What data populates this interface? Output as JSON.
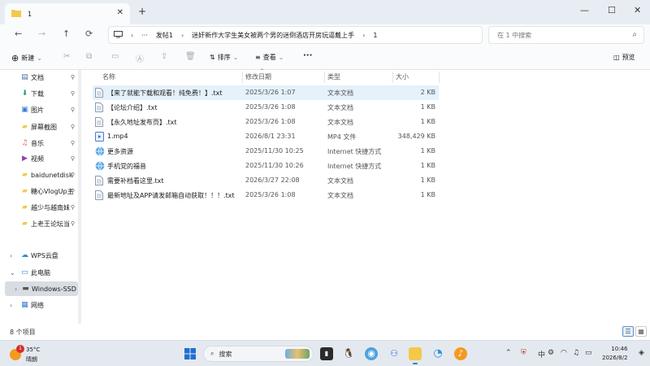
{
  "tab": {
    "title": "1",
    "close": "✕",
    "new": "+"
  },
  "window_controls": {
    "minimize": "—",
    "maximize": "☐",
    "close": "✕"
  },
  "nav": {
    "back": "←",
    "forward": "→",
    "up": "↑",
    "refresh": "⟳",
    "more": "···"
  },
  "address": {
    "segments": [
      "发帖1",
      "迷奸新作大学生美女被两个男的迷倒酒店开房玩逼戴上手",
      "1"
    ],
    "separator": "›"
  },
  "search": {
    "placeholder": "在 1 中搜索"
  },
  "commands": {
    "new": "新建",
    "sort": "排序",
    "view": "查看",
    "more": "···",
    "preview": "预览"
  },
  "columns": {
    "name": "名称",
    "date": "修改日期",
    "type": "类型",
    "size": "大小"
  },
  "files": [
    {
      "name": "【来了就能下载和观看！纯免费！】.txt",
      "date": "2025/3/26 1:07",
      "type": "文本文档",
      "size": "2 KB",
      "icon": "text-file-icon"
    },
    {
      "name": "【论坛介绍】.txt",
      "date": "2025/3/26 1:08",
      "type": "文本文档",
      "size": "1 KB",
      "icon": "text-file-icon"
    },
    {
      "name": "【永久地址发布页】.txt",
      "date": "2025/3/26 1:08",
      "type": "文本文档",
      "size": "1 KB",
      "icon": "text-file-icon"
    },
    {
      "name": "1.mp4",
      "date": "2026/8/1 23:31",
      "type": "MP4 文件",
      "size": "348,429 KB",
      "icon": "video-file-icon"
    },
    {
      "name": "更多资源",
      "date": "2025/11/30 10:25",
      "type": "Internet 快捷方式",
      "size": "1 KB",
      "icon": "internet-shortcut-icon"
    },
    {
      "name": "手机党的福音",
      "date": "2025/11/30 10:26",
      "type": "Internet 快捷方式",
      "size": "1 KB",
      "icon": "internet-shortcut-icon"
    },
    {
      "name": "需要补档看这里.txt",
      "date": "2026/3/27 22:08",
      "type": "文本文档",
      "size": "1 KB",
      "icon": "text-file-icon"
    },
    {
      "name": "最新地址及APP请发邮箱自动获取！！！.txt",
      "date": "2025/3/26 1:08",
      "type": "文本文档",
      "size": "1 KB",
      "icon": "text-file-icon"
    }
  ],
  "sidebar": [
    {
      "label": "文档",
      "icon": "documents-icon",
      "pinned": true
    },
    {
      "label": "下载",
      "icon": "downloads-icon",
      "pinned": true
    },
    {
      "label": "图片",
      "icon": "pictures-icon",
      "pinned": true
    },
    {
      "label": "屏幕截图",
      "icon": "folder-icon",
      "pinned": true
    },
    {
      "label": "音乐",
      "icon": "music-icon",
      "pinned": true
    },
    {
      "label": "视频",
      "icon": "videos-icon",
      "pinned": true
    },
    {
      "label": "baidunetdisk",
      "icon": "folder-icon",
      "pinned": true
    },
    {
      "label": "糖心VlogUp主",
      "icon": "folder-icon",
      "pinned": true
    },
    {
      "label": "越少与越南妹",
      "icon": "folder-icon",
      "pinned": true
    },
    {
      "label": "上老王论坛当",
      "icon": "folder-icon",
      "pinned": true
    },
    {
      "label": "WPS云盘",
      "icon": "cloud-icon",
      "pinned": false
    },
    {
      "label": "此电脑",
      "icon": "this-pc-icon",
      "pinned": false
    },
    {
      "label": "Windows-SSD",
      "icon": "drive-icon",
      "pinned": false
    },
    {
      "label": "网络",
      "icon": "network-icon",
      "pinned": false
    }
  ],
  "status": {
    "item_count": "8 个项目"
  },
  "taskbar": {
    "weather_temp": "35°C",
    "weather_cond": "晴朗",
    "weather_badge": "1",
    "search_label": "搜索",
    "time": "10:46",
    "date": "2026/8/2",
    "ime": "中"
  },
  "colors": {
    "accent": "#3a7bd5",
    "selected_row": "#e5f1fb",
    "folder": "#f3c94a"
  }
}
